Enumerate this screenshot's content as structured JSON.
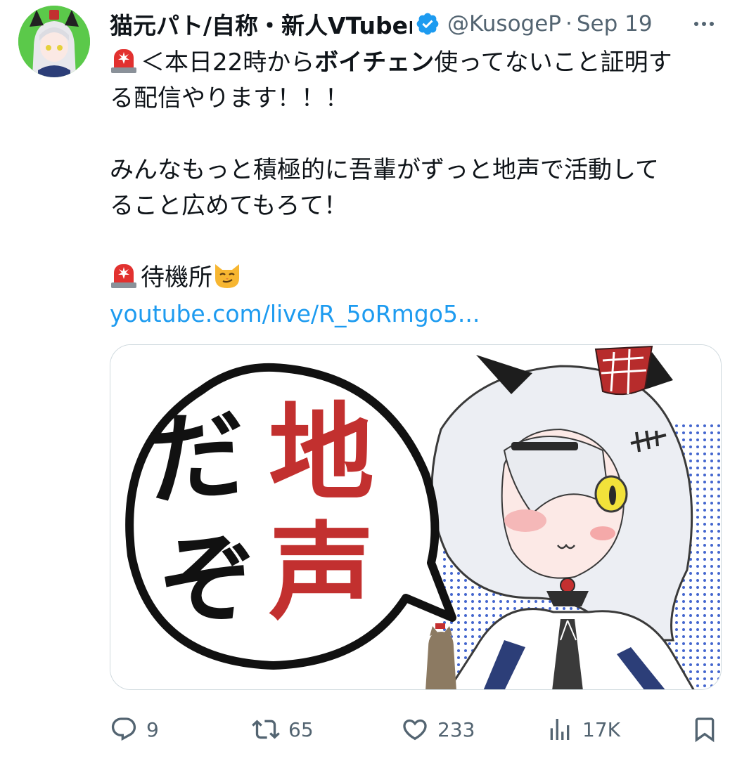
{
  "author": {
    "display_name": "猫元パト/自称・新人VTuber",
    "handle": "@KusogeP",
    "separator": "·",
    "date": "Sep 19"
  },
  "tweet": {
    "line1_pre": "＜本日22時から",
    "line1_bold": "ボイチェン",
    "line1_post": "使ってないこと証明す",
    "line2": "る配信やります！！！",
    "line3": "みんなもっと積極的に吾輩がずっと地声で活動して",
    "line4": "ること広めてもろて！",
    "line5": "待機所",
    "link": "youtube.com/live/R_5oRmgo5..."
  },
  "media": {
    "bubble_text_black_1": "だ",
    "bubble_text_black_2": "ぞ",
    "bubble_text_red_1": "地",
    "bubble_text_red_2": "声"
  },
  "actions": {
    "reply_count": "9",
    "retweet_count": "65",
    "like_count": "233",
    "views_count": "17K"
  },
  "icons": {
    "verified": "verified-badge-icon",
    "more": "more-icon",
    "siren": "siren-emoji",
    "cat": "smirking-cat-emoji",
    "reply": "reply-icon",
    "retweet": "retweet-icon",
    "like": "heart-icon",
    "views": "views-icon",
    "bookmark": "bookmark-icon"
  },
  "colors": {
    "text": "#0f1419",
    "muted": "#536471",
    "link": "#1d9bf0",
    "verified": "#1d9bf0",
    "red_text": "#c2302f"
  }
}
